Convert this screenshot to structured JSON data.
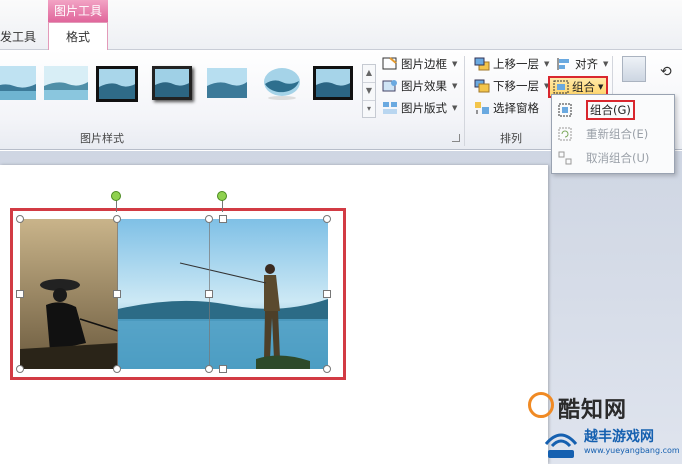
{
  "tabs": {
    "dev_tools": "发工具",
    "context_header": "图片工具",
    "format": "格式"
  },
  "ribbon": {
    "picture_styles_label": "图片样式",
    "arrange_label": "排列",
    "commands": {
      "picture_border": "图片边框",
      "picture_effects": "图片效果",
      "picture_layout": "图片版式",
      "bring_forward": "上移一层",
      "send_backward": "下移一层",
      "selection_pane": "选择窗格",
      "align": "对齐",
      "group": "组合"
    }
  },
  "group_menu": {
    "items": [
      {
        "label": "组合(G)",
        "enabled": true
      },
      {
        "label": "重新组合(E)",
        "enabled": false
      },
      {
        "label": "取消组合(U)",
        "enabled": false
      }
    ]
  },
  "watermarks": {
    "site1": "酷知网",
    "site2": "越丰游戏网",
    "site2_url": "www.yueyangbang.com"
  },
  "colors": {
    "highlight_red": "#d9272e",
    "context_pink": "#e0669b"
  }
}
